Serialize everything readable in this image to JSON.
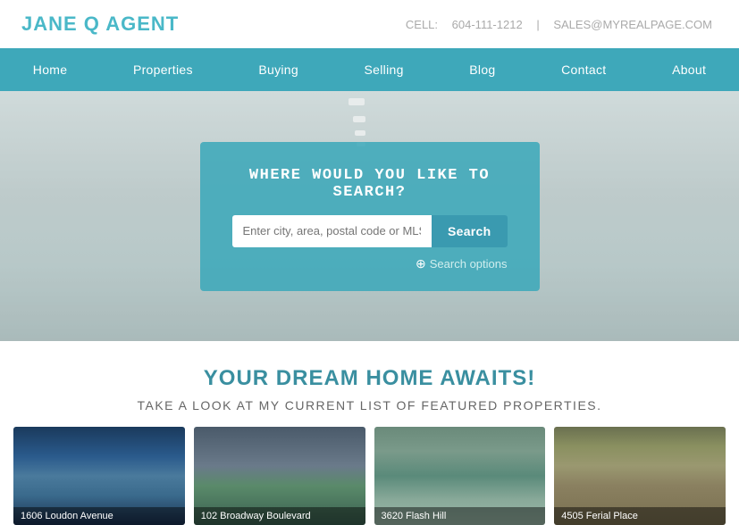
{
  "header": {
    "logo": "JANE Q AGENT",
    "cell_label": "CELL:",
    "cell_number": "604-111-1212",
    "separator": "|",
    "email": "SALES@MYREALPAGE.COM"
  },
  "nav": {
    "items": [
      {
        "label": "Home",
        "href": "#"
      },
      {
        "label": "Properties",
        "href": "#"
      },
      {
        "label": "Buying",
        "href": "#"
      },
      {
        "label": "Selling",
        "href": "#"
      },
      {
        "label": "Blog",
        "href": "#"
      },
      {
        "label": "Contact",
        "href": "#"
      },
      {
        "label": "About",
        "href": "#"
      }
    ]
  },
  "hero": {
    "search_title": "Where Would You Like To Search?",
    "search_placeholder": "Enter city, area, postal code or MLS(r) number",
    "search_button": "Search",
    "search_options_label": "Search options"
  },
  "dream_section": {
    "title": "YOUR DREAM HOME AWAITS!",
    "subtitle": "TAKE A LOOK AT MY CURRENT LIST OF FEATURED PROPERTIES."
  },
  "properties": [
    {
      "label": "1606 Loudon Avenue"
    },
    {
      "label": "102 Broadway Boulevard"
    },
    {
      "label": "3620 Flash Hill"
    },
    {
      "label": "4505 Ferial Place"
    }
  ]
}
